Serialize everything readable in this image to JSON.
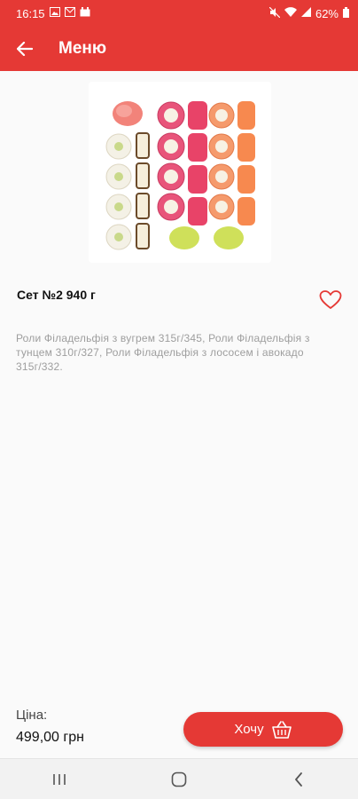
{
  "status_bar": {
    "time": "16:15",
    "battery": "62%",
    "icons_left": [
      "gallery-icon",
      "mail-icon",
      "calendar-icon"
    ],
    "icons_right": [
      "mute-icon",
      "wifi-icon",
      "signal-icon",
      "battery-icon"
    ]
  },
  "app_bar": {
    "title": "Меню",
    "back_icon": "arrow-left-icon",
    "color": "#e53935"
  },
  "product": {
    "image_icon": "sushi-set-image",
    "title": "Сет №2 940 г",
    "favorite_icon": "heart-outline-icon",
    "description": "Роли Філадельфія з вугрем 315г/345, Роли Філадельфія з тунцем  310г/327, Роли Філадельфія з лососем і авокадо 315г/332."
  },
  "footer": {
    "price_label": "Ціна:",
    "price_value": "499,00 грн",
    "want_button_label": "Хочу",
    "basket_icon": "basket-icon"
  },
  "nav_bar": {
    "items": [
      "recents-icon",
      "home-icon",
      "back-icon"
    ]
  }
}
